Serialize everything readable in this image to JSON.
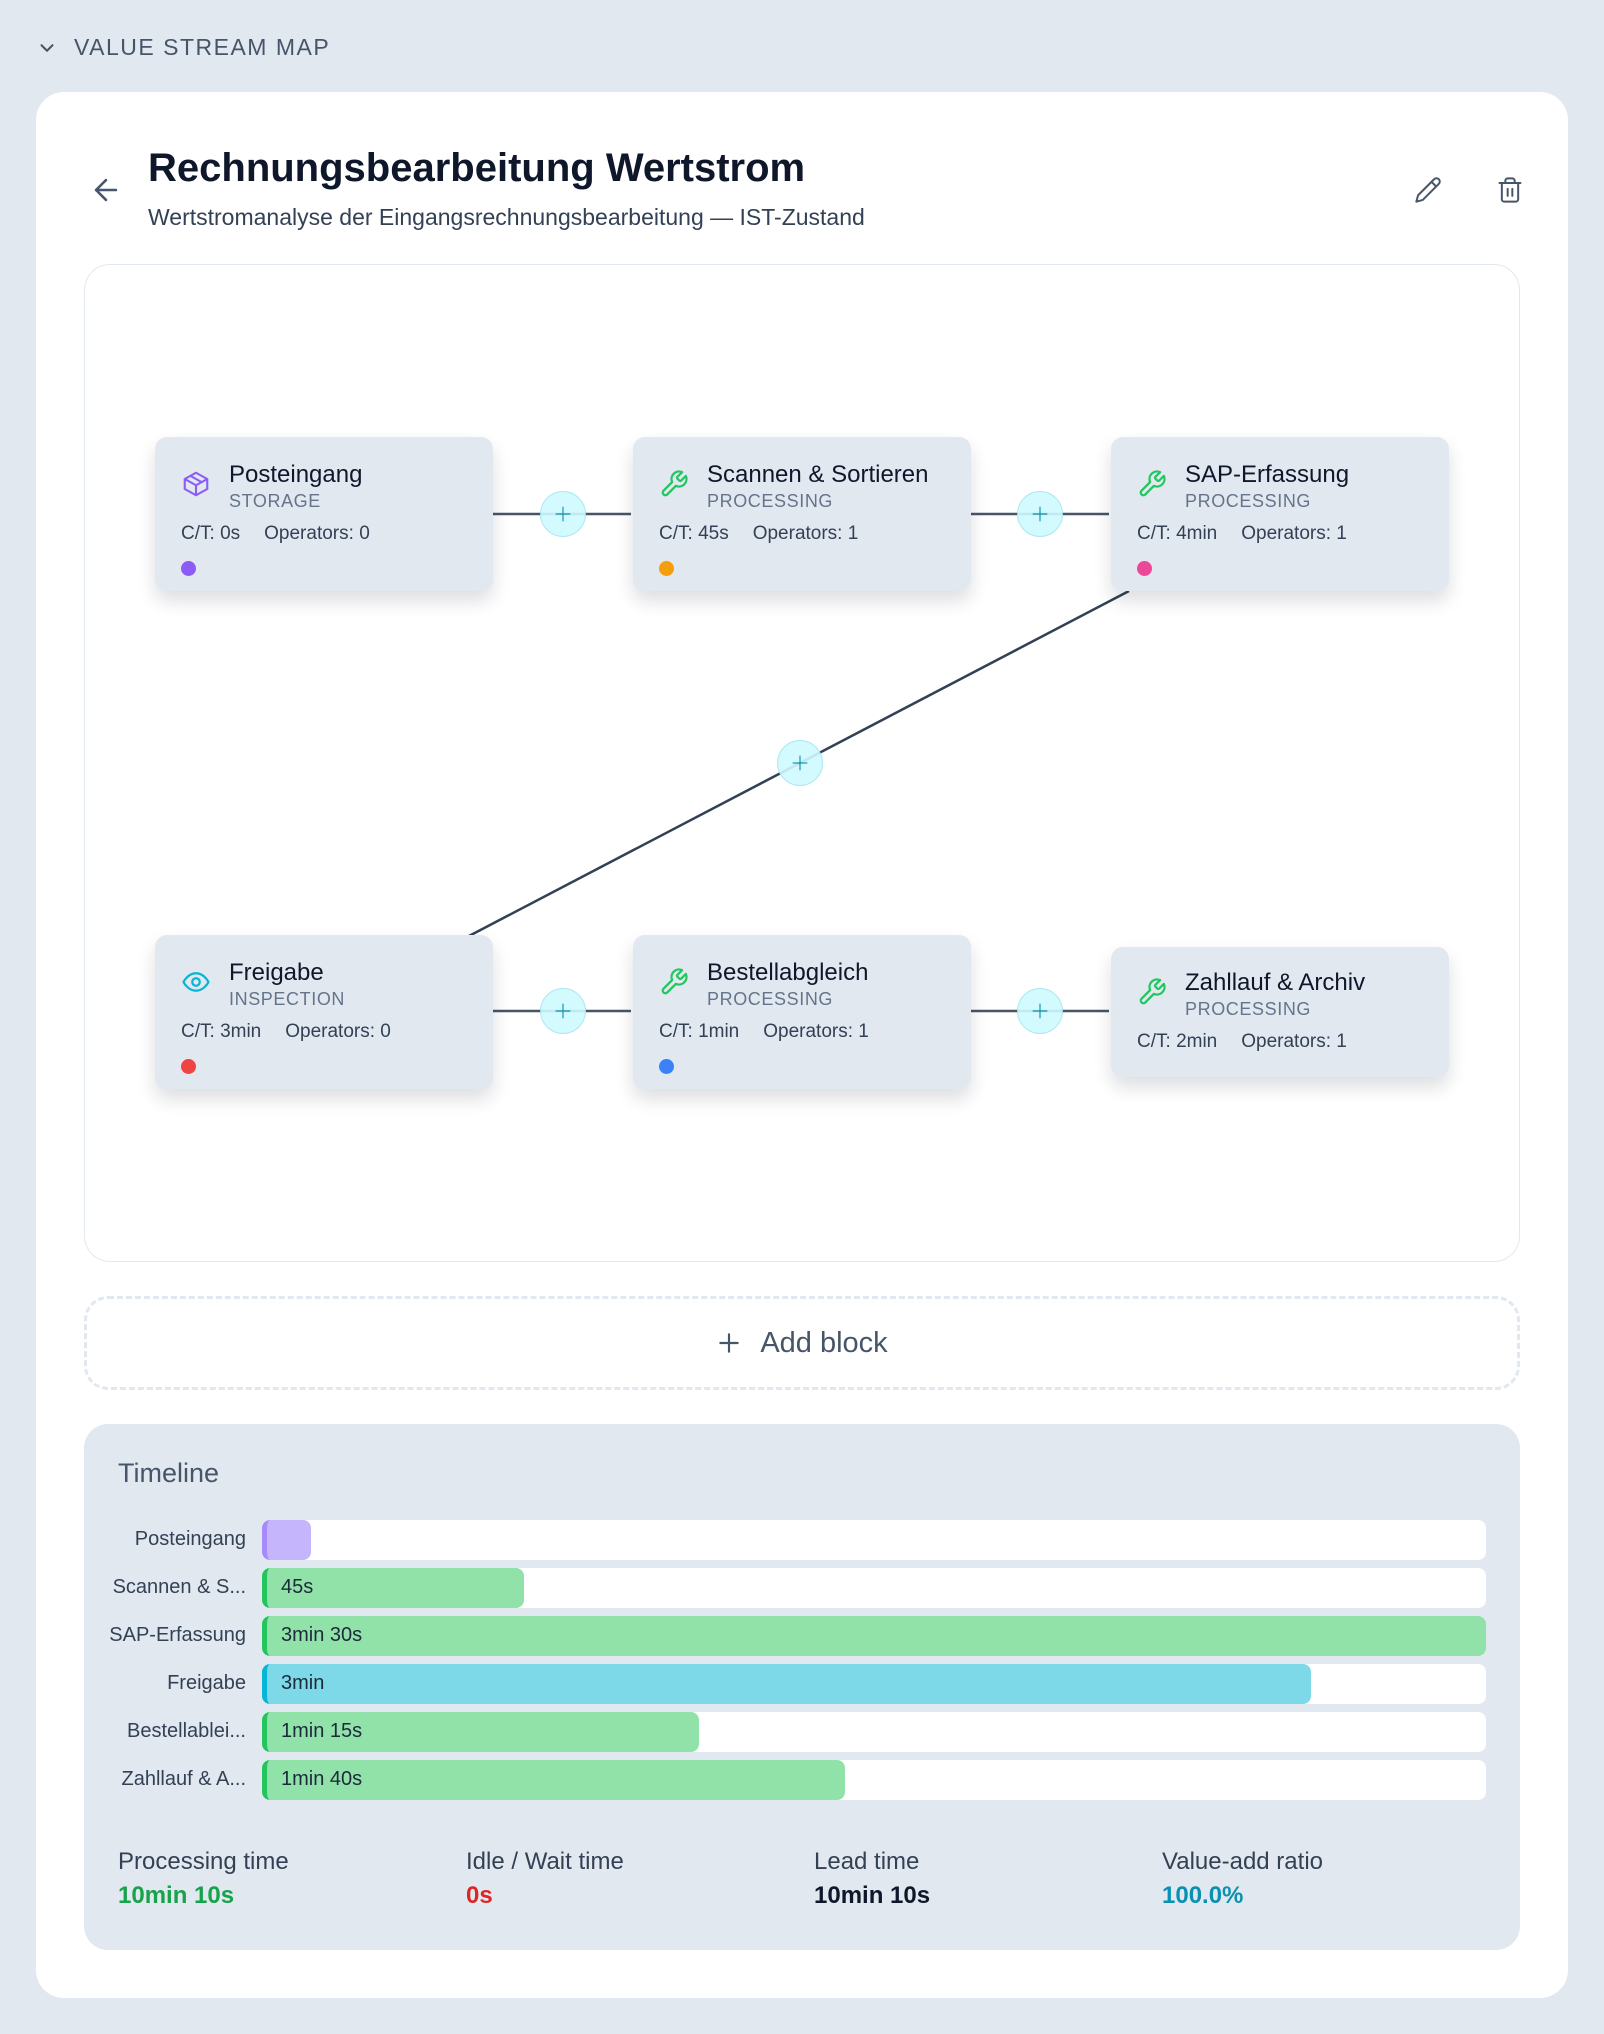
{
  "section": {
    "title": "VALUE STREAM MAP",
    "toggle_icon": "chevron-down-icon"
  },
  "header": {
    "title": "Rechnungsbearbeitung Wertstrom",
    "subtitle": "Wertstromanalyse der Eingangsrechnungsbearbeitung — IST-Zustand",
    "back_icon": "arrow-left-icon",
    "edit_icon": "pencil-icon",
    "delete_icon": "trash-icon"
  },
  "labels": {
    "ct_prefix": "C/T: ",
    "operators_prefix": "Operators: "
  },
  "blocks": [
    {
      "name": "Posteingang",
      "type": "STORAGE",
      "ct": "0s",
      "operators": "0",
      "icon": "box-icon",
      "icon_color": "#8b5cf6",
      "dot_color": "#8b5cf6"
    },
    {
      "name": "Scannen & Sortieren",
      "type": "PROCESSING",
      "ct": "45s",
      "operators": "1",
      "icon": "wrench-icon",
      "icon_color": "#22c55e",
      "dot_color": "#f59e0b"
    },
    {
      "name": "SAP-Erfassung",
      "type": "PROCESSING",
      "ct": "4min",
      "operators": "1",
      "icon": "wrench-icon",
      "icon_color": "#22c55e",
      "dot_color": "#ec4899"
    },
    {
      "name": "Freigabe",
      "type": "INSPECTION",
      "ct": "3min",
      "operators": "0",
      "icon": "eye-icon",
      "icon_color": "#06b6d4",
      "dot_color": "#ef4444"
    },
    {
      "name": "Bestellabgleich",
      "type": "PROCESSING",
      "ct": "1min",
      "operators": "1",
      "icon": "wrench-icon",
      "icon_color": "#22c55e",
      "dot_color": "#3b82f6"
    },
    {
      "name": "Zahllauf & Archiv",
      "type": "PROCESSING",
      "ct": "2min",
      "operators": "1",
      "icon": "wrench-icon",
      "icon_color": "#22c55e",
      "dot_color": null
    }
  ],
  "add_block": {
    "label": "Add block",
    "icon": "plus-icon"
  },
  "timeline": {
    "title": "Timeline",
    "rows": [
      {
        "label": "Posteingang",
        "value": "",
        "fraction": 0.04,
        "color": "#c4b5fd",
        "edge": "#a78bfa"
      },
      {
        "label": "Scannen & S...",
        "value": "45s",
        "fraction": 0.214,
        "color": "#90e2a9",
        "edge": "#22c55e"
      },
      {
        "label": "SAP-Erfassung",
        "value": "3min 30s",
        "fraction": 1.0,
        "color": "#90e2a9",
        "edge": "#22c55e"
      },
      {
        "label": "Freigabe",
        "value": "3min",
        "fraction": 0.857,
        "color": "#7dd8e8",
        "edge": "#06b6d4"
      },
      {
        "label": "Bestellablei...",
        "value": "1min 15s",
        "fraction": 0.357,
        "color": "#90e2a9",
        "edge": "#22c55e"
      },
      {
        "label": "Zahllauf & A...",
        "value": "1min 40s",
        "fraction": 0.476,
        "color": "#90e2a9",
        "edge": "#22c55e"
      }
    ]
  },
  "metrics": [
    {
      "label": "Processing time",
      "value": "10min 10s",
      "color": "#16a34a"
    },
    {
      "label": "Idle / Wait time",
      "value": "0s",
      "color": "#dc2626"
    },
    {
      "label": "Lead time",
      "value": "10min 10s",
      "color": "#0f172a"
    },
    {
      "label": "Value-add ratio",
      "value": "100.0%",
      "color": "#0891b2"
    }
  ]
}
